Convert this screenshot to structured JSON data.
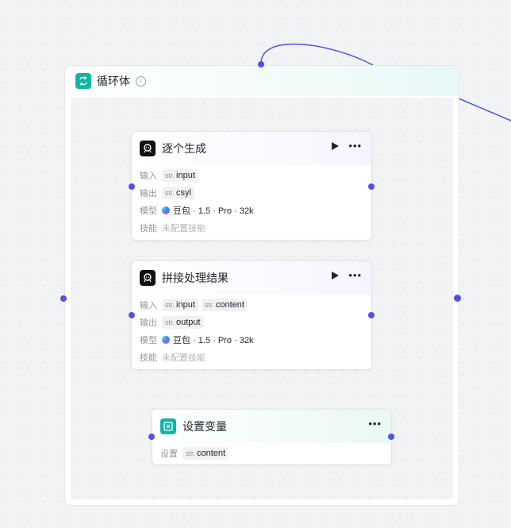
{
  "colors": {
    "accent": "#4e52e6",
    "teal": "#10b5a6"
  },
  "loop": {
    "title": "循环体",
    "icon": "loop-arrows-icon"
  },
  "labels": {
    "input": "输入",
    "output": "输出",
    "model": "模型",
    "skill": "技能",
    "set": "设置"
  },
  "nodes": [
    {
      "title": "逐个生成",
      "inputs": [
        {
          "type": "str.",
          "name": "input"
        }
      ],
      "outputs": [
        {
          "type": "str.",
          "name": "csyl"
        }
      ],
      "model": "豆包 · 1.5 · Pro · 32k",
      "skill": "未配置技能"
    },
    {
      "title": "拼接处理结果",
      "inputs": [
        {
          "type": "str.",
          "name": "input"
        },
        {
          "type": "str.",
          "name": "content"
        }
      ],
      "outputs": [
        {
          "type": "str.",
          "name": "output"
        }
      ],
      "model": "豆包 · 1.5 · Pro · 32k",
      "skill": "未配置技能"
    },
    {
      "title": "设置变量",
      "sets": [
        {
          "type": "str.",
          "name": "content"
        }
      ]
    }
  ]
}
